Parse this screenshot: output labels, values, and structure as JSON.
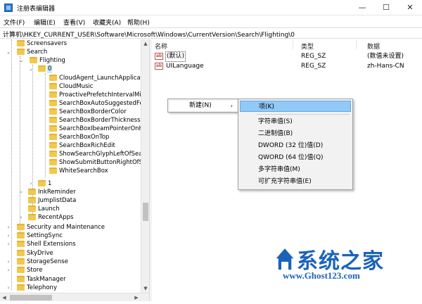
{
  "window": {
    "title": "注册表编辑器",
    "controls": {
      "minimize": "—",
      "maximize": "☐",
      "close": "✕"
    }
  },
  "menu": [
    "文件(F)",
    "编辑(E)",
    "查看(V)",
    "收藏夹(A)",
    "帮助(H)"
  ],
  "address": "计算机\\HKEY_CURRENT_USER\\Software\\Microsoft\\Windows\\CurrentVersion\\Search\\Flighting\\0",
  "tree": {
    "screensavers": "Screensavers",
    "search": "Search",
    "flighting": "Flighting",
    "node0": "0",
    "children0": [
      "CloudAgent_LaunchApplication",
      "CloudMusic",
      "ProactivePrefetchIntervalMinute",
      "SearchBoxAutoSuggestedFore",
      "SearchBoxBorderColor",
      "SearchBoxBorderThickness",
      "SearchBoxIbeamPointerOnHov",
      "SearchBoxOnTop",
      "SearchBoxRichEdit",
      "ShowSearchGlyphLeftOfSearch",
      "ShowSubmitButtonRightOfSear",
      "WhiteSearchBox"
    ],
    "node1": "1",
    "search_children": [
      "InkReminder",
      "JumplistData",
      "Launch",
      "RecentApps"
    ],
    "top_level": [
      "Security and Maintenance",
      "SettingSync",
      "Shell Extensions",
      "SkyDrive",
      "StorageSense",
      "Store",
      "TaskManager",
      "Telephony"
    ]
  },
  "columns": {
    "name": "名称",
    "type": "类型",
    "data": "数据"
  },
  "values": [
    {
      "icon": "ab",
      "name": "(默认)",
      "type": "REG_SZ",
      "data": "(数值未设置)"
    },
    {
      "icon": "ab",
      "name": "UILanguage",
      "type": "REG_SZ",
      "data": "zh-Hans-CN"
    }
  ],
  "context_menu": {
    "label": "新建(N)",
    "arrow": "›"
  },
  "submenu": {
    "key": "项(K)",
    "items": [
      "字符串值(S)",
      "二进制值(B)",
      "DWORD (32 位)值(D)",
      "QWORD (64 位)值(Q)",
      "多字符串值(M)",
      "可扩充字符串值(E)"
    ]
  },
  "watermark": {
    "title": "系统之家",
    "url": "www.Ghost123.com"
  },
  "colors": {
    "accent": "#1b63b8",
    "highlight": "#91c9f7",
    "folder": "#f2c94c"
  }
}
